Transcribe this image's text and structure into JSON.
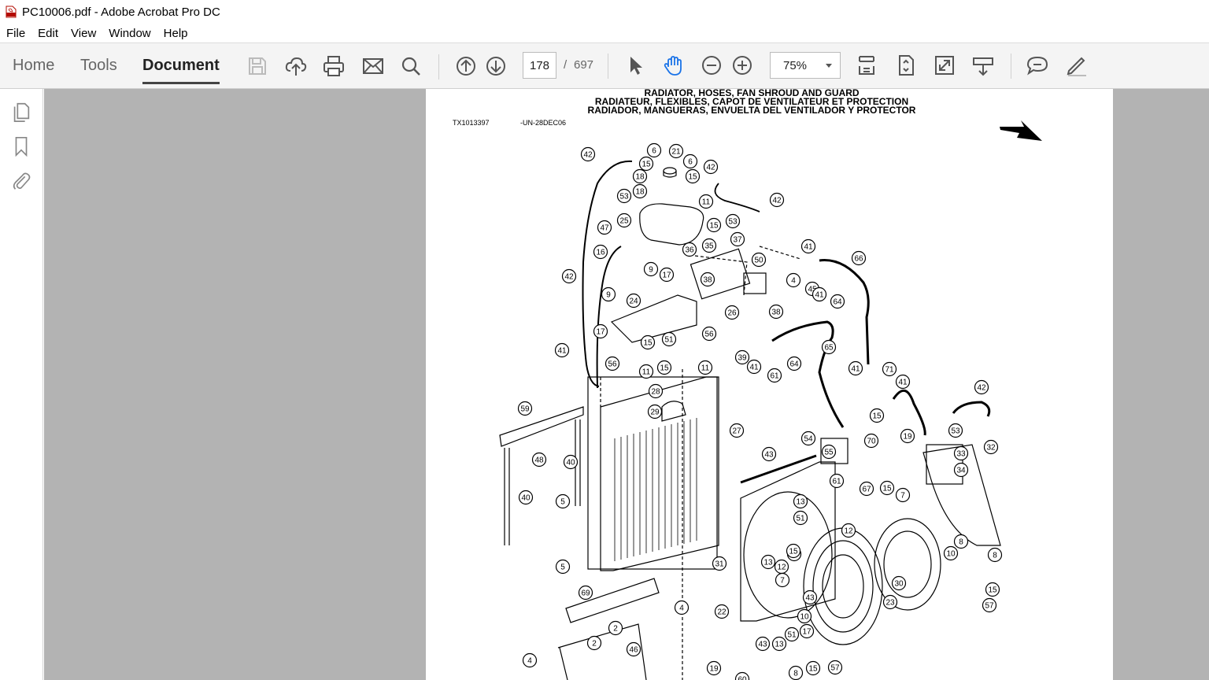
{
  "window": {
    "title": "PC10006.pdf - Adobe Acrobat Pro DC"
  },
  "menu": {
    "items": [
      "File",
      "Edit",
      "View",
      "Window",
      "Help"
    ]
  },
  "toolbar": {
    "tabs": [
      "Home",
      "Tools",
      "Document"
    ],
    "active_tab": "Document",
    "page_current": "178",
    "page_separator": "/",
    "page_total": "697",
    "zoom": "75%",
    "icons": [
      "save-icon",
      "upload-cloud-icon",
      "print-icon",
      "mail-icon",
      "search-icon",
      "arrow-up-circle-icon",
      "arrow-down-circle-icon",
      "select-cursor-icon",
      "hand-tool-icon",
      "zoom-out-icon",
      "zoom-in-icon",
      "fit-page-icon",
      "page-scroll-icon",
      "full-screen-icon",
      "read-mode-icon",
      "comment-icon",
      "pen-icon"
    ],
    "accent_color": "#1a73e8"
  },
  "left_panel": {
    "icons": [
      "page-thumbnails-icon",
      "bookmark-icon",
      "attachment-icon"
    ]
  },
  "document": {
    "heading_lines": [
      "RADIATOR, HOSES, FAN SHROUD AND GUARD",
      "RADIATEUR, FLEXIBLES, CAPOT DE VENTILATEUR ET PROTECTION",
      "RADIADOR, MANGUERAS, ENVUELTA DEL VENTILADOR Y PROTECTOR"
    ],
    "code_left": "TX1013397",
    "code_right": "-UN-28DEC06",
    "callouts": [
      "42",
      "6",
      "21",
      "6",
      "15",
      "18",
      "15",
      "18",
      "42",
      "53",
      "11",
      "53",
      "42",
      "25",
      "15",
      "47",
      "37",
      "16",
      "36",
      "35",
      "50",
      "41",
      "66",
      "42",
      "38",
      "4",
      "9",
      "17",
      "45",
      "41",
      "64",
      "9",
      "24",
      "26",
      "38",
      "17",
      "51",
      "56",
      "15",
      "41",
      "39",
      "41",
      "64",
      "65",
      "41",
      "71",
      "56",
      "11",
      "15",
      "11",
      "61",
      "41",
      "15",
      "28",
      "42",
      "29",
      "59",
      "27",
      "53",
      "54",
      "70",
      "19",
      "32",
      "48",
      "40",
      "43",
      "55",
      "33",
      "34",
      "40",
      "61",
      "67",
      "15",
      "7",
      "5",
      "13",
      "51",
      "12",
      "15",
      "8",
      "5",
      "13",
      "12",
      "15",
      "7",
      "10",
      "8",
      "31",
      "30",
      "69",
      "4",
      "22",
      "43",
      "23",
      "57",
      "2",
      "10",
      "17",
      "2",
      "51",
      "43",
      "13",
      "4",
      "46",
      "19",
      "60",
      "8",
      "15",
      "57",
      "15"
    ]
  }
}
